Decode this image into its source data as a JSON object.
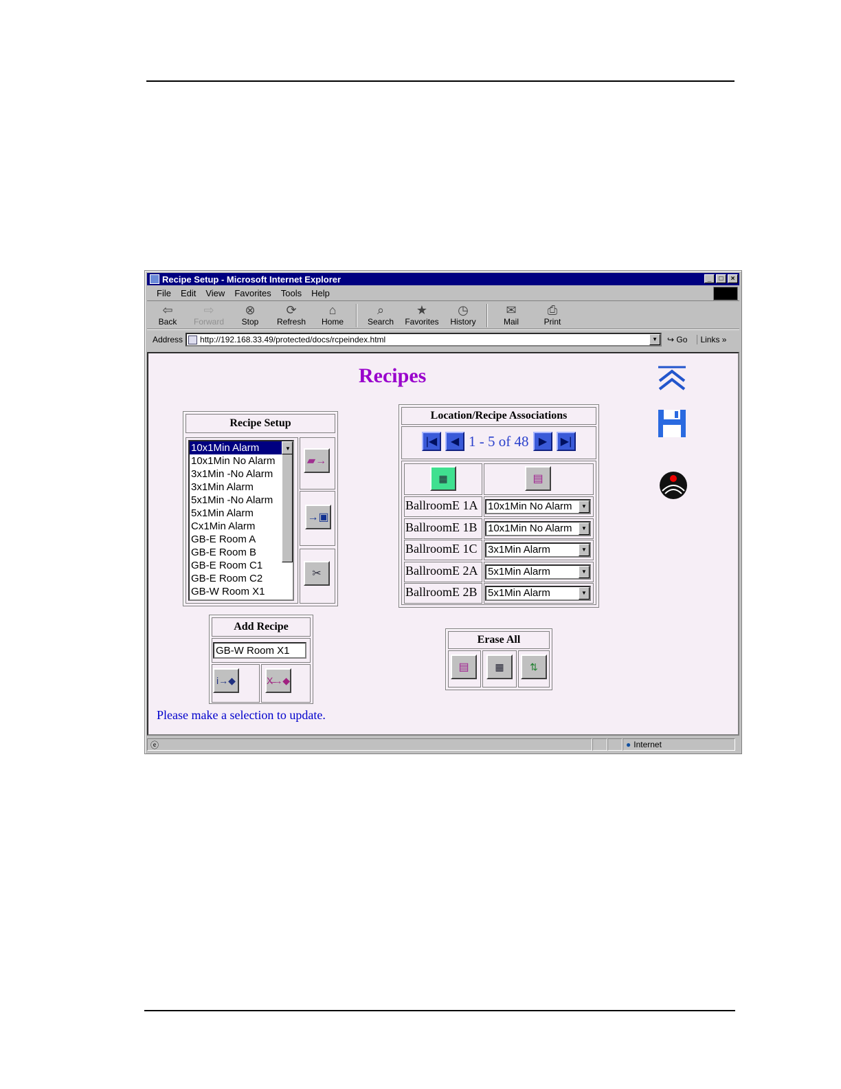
{
  "window": {
    "title": "Recipe Setup - Microsoft Internet Explorer"
  },
  "menu": [
    "File",
    "Edit",
    "View",
    "Favorites",
    "Tools",
    "Help"
  ],
  "toolbar": [
    {
      "label": "Back",
      "icon": "back-arrow-icon",
      "glyph": "⇦"
    },
    {
      "label": "Forward",
      "icon": "forward-arrow-icon",
      "glyph": "⇨"
    },
    {
      "label": "Stop",
      "icon": "stop-icon",
      "glyph": "⊗"
    },
    {
      "label": "Refresh",
      "icon": "refresh-icon",
      "glyph": "⟳"
    },
    {
      "label": "Home",
      "icon": "home-icon",
      "glyph": "⌂"
    },
    {
      "label": "Search",
      "icon": "search-icon",
      "glyph": "⌕"
    },
    {
      "label": "Favorites",
      "icon": "favorites-icon",
      "glyph": "★"
    },
    {
      "label": "History",
      "icon": "history-icon",
      "glyph": "◷"
    },
    {
      "label": "Mail",
      "icon": "mail-icon",
      "glyph": "✉"
    },
    {
      "label": "Print",
      "icon": "print-icon",
      "glyph": "⎙"
    }
  ],
  "address": {
    "label": "Address",
    "url": "http://192.168.33.49/protected/docs/rcpeindex.html",
    "go": "Go",
    "links": "Links"
  },
  "page": {
    "title": "Recipes",
    "message": "Please make a selection to update."
  },
  "recipe_setup": {
    "header": "Recipe Setup",
    "items": [
      "10x1Min Alarm",
      "10x1Min No Alarm",
      "3x1Min -No Alarm",
      "3x1Min Alarm",
      "5x1Min -No Alarm",
      "5x1Min Alarm",
      "Cx1Min Alarm",
      "GB-E Room A",
      "GB-E Room B",
      "GB-E Room C1",
      "GB-E Room C2",
      "GB-W Room X1"
    ],
    "selected_index": 0
  },
  "add_recipe": {
    "header": "Add Recipe",
    "value": "GB-W Room X1"
  },
  "associations": {
    "header": "Location/Recipe Associations",
    "pager": "1 - 5 of 48",
    "rows": [
      {
        "location": "BallroomE 1A",
        "recipe": "10x1Min No Alarm"
      },
      {
        "location": "BallroomE 1B",
        "recipe": "10x1Min No Alarm"
      },
      {
        "location": "BallroomE 1C",
        "recipe": "3x1Min Alarm"
      },
      {
        "location": "BallroomE 2A",
        "recipe": "5x1Min Alarm"
      },
      {
        "location": "BallroomE 2B",
        "recipe": "5x1Min Alarm"
      }
    ]
  },
  "erase_all": {
    "header": "Erase All"
  },
  "status": {
    "zone": "Internet"
  },
  "colors": {
    "title_bar": "#000080",
    "page_title": "#9900cc",
    "link_text": "#0000cc",
    "page_bg": "#f6eef6",
    "nav_blue": "#3a5ad8"
  }
}
